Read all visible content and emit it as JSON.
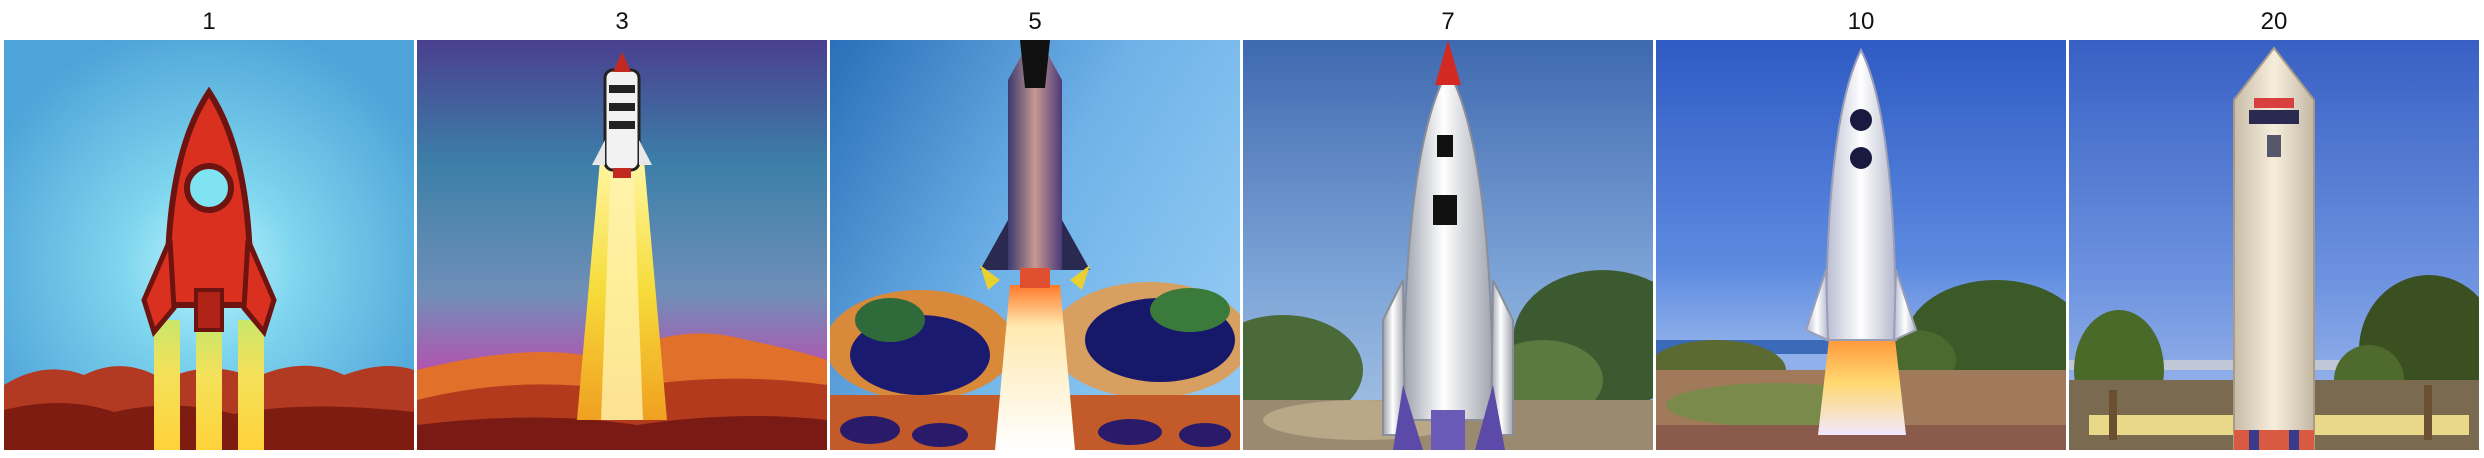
{
  "figure": {
    "panels": [
      {
        "label": "1"
      },
      {
        "label": "3"
      },
      {
        "label": "5"
      },
      {
        "label": "7"
      },
      {
        "label": "10"
      },
      {
        "label": "20"
      }
    ]
  }
}
